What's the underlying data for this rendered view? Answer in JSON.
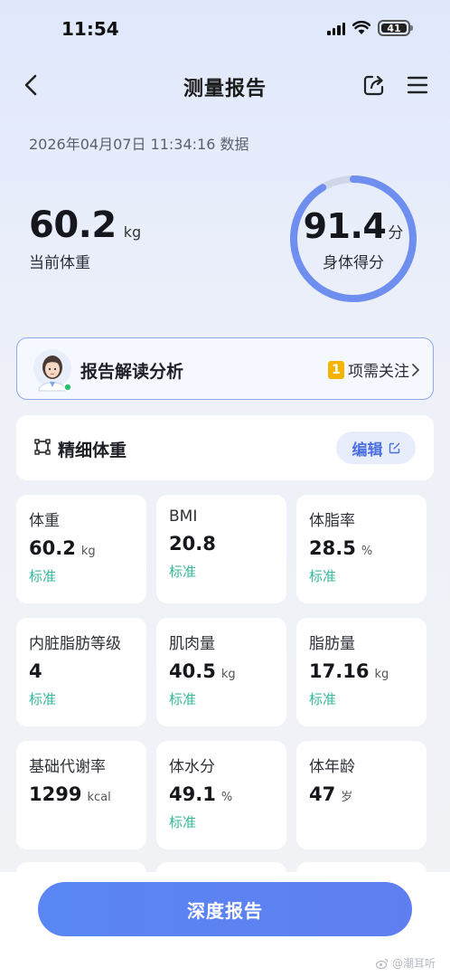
{
  "status_bar": {
    "time": "11:54",
    "battery": "41"
  },
  "nav": {
    "title": "测量报告"
  },
  "report": {
    "date": "2026年04月07日 11:34:16 数据",
    "weight_value": "60.2",
    "weight_unit": "kg",
    "weight_label": "当前体重",
    "score_value": "91.4",
    "score_unit": "分",
    "score_label": "身体得分",
    "score_fraction": 0.914
  },
  "analysis": {
    "title": "报告解读分析",
    "attention_count": "1",
    "attention_text": "项需关注"
  },
  "fine_weight": {
    "title": "精细体重",
    "edit_label": "编辑"
  },
  "metrics": [
    {
      "name": "体重",
      "value": "60.2",
      "unit": "kg",
      "status": "标准"
    },
    {
      "name": "BMI",
      "value": "20.8",
      "unit": "",
      "status": "标准"
    },
    {
      "name": "体脂率",
      "value": "28.5",
      "unit": "%",
      "status": "标准"
    },
    {
      "name": "内脏脂肪等级",
      "value": "4",
      "unit": "",
      "status": "标准"
    },
    {
      "name": "肌肉量",
      "value": "40.5",
      "unit": "kg",
      "status": "标准"
    },
    {
      "name": "脂肪量",
      "value": "17.16",
      "unit": "kg",
      "status": "标准"
    },
    {
      "name": "基础代谢率",
      "value": "1299",
      "unit": "kcal",
      "status": ""
    },
    {
      "name": "体水分",
      "value": "49.1",
      "unit": "%",
      "status": "标准"
    },
    {
      "name": "体年龄",
      "value": "47",
      "unit": "岁",
      "status": ""
    }
  ],
  "bottom": {
    "deep_report_label": "深度报告",
    "watermark": "@潮耳听"
  },
  "colors": {
    "accent": "#5a86f3",
    "status_ok": "#35b89b",
    "badge": "#f5b400"
  }
}
